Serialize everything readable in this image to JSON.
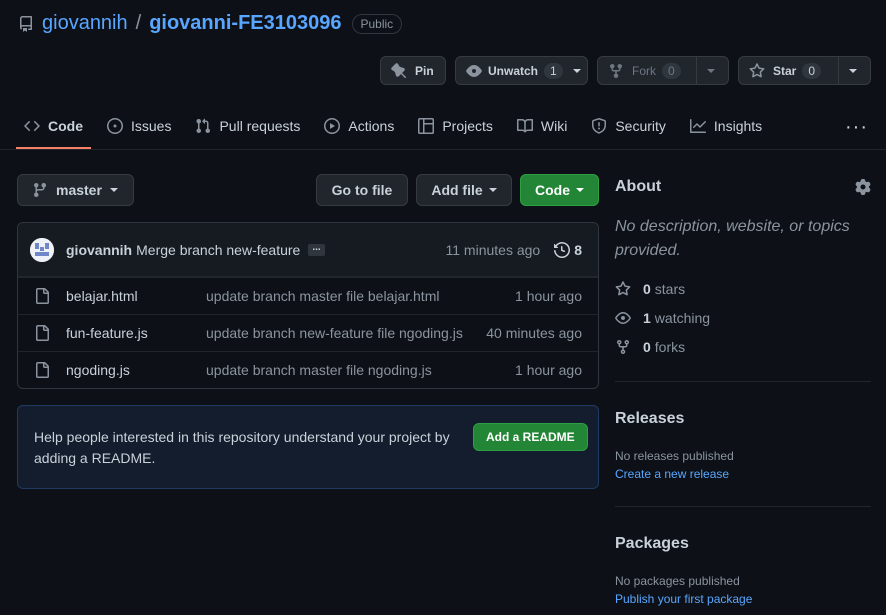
{
  "repo": {
    "owner": "giovannih",
    "separator": "/",
    "name": "giovanni-FE3103096",
    "visibility": "Public"
  },
  "actions": {
    "pin": "Pin",
    "unwatch": "Unwatch",
    "watch_count": "1",
    "fork": "Fork",
    "fork_count": "0",
    "star": "Star",
    "star_count": "0"
  },
  "tabs": [
    {
      "label": "Code",
      "icon": "code-icon",
      "active": true
    },
    {
      "label": "Issues",
      "icon": "issue-icon"
    },
    {
      "label": "Pull requests",
      "icon": "pull-request-icon"
    },
    {
      "label": "Actions",
      "icon": "play-icon"
    },
    {
      "label": "Projects",
      "icon": "table-icon"
    },
    {
      "label": "Wiki",
      "icon": "book-icon"
    },
    {
      "label": "Security",
      "icon": "shield-icon"
    },
    {
      "label": "Insights",
      "icon": "graph-icon"
    }
  ],
  "more": "···",
  "toolbar": {
    "branch": "master",
    "go_to_file": "Go to file",
    "add_file": "Add file",
    "code": "Code"
  },
  "commit": {
    "author": "giovannih",
    "message": "Merge branch new-feature",
    "ellipsis": "...",
    "time": "11 minutes ago",
    "count": "8"
  },
  "files": [
    {
      "name": "belajar.html",
      "message": "update branch master file belajar.html",
      "time": "1 hour ago"
    },
    {
      "name": "fun-feature.js",
      "message": "update branch new-feature file ngoding.js",
      "time": "40 minutes ago"
    },
    {
      "name": "ngoding.js",
      "message": "update branch master file ngoding.js",
      "time": "1 hour ago"
    }
  ],
  "readme": {
    "text": "Help people interested in this repository understand your project by adding a README.",
    "button": "Add a README"
  },
  "about": {
    "title": "About",
    "description": "No description, website, or topics provided.",
    "stars_count": "0",
    "stars_label": "stars",
    "watching_count": "1",
    "watching_label": "watching",
    "forks_count": "0",
    "forks_label": "forks"
  },
  "releases": {
    "title": "Releases",
    "none": "No releases published",
    "link": "Create a new release"
  },
  "packages": {
    "title": "Packages",
    "none": "No packages published",
    "link": "Publish your first package"
  },
  "colors": {
    "background": "#0d1117",
    "link": "#58a6ff",
    "green_button": "#238636",
    "tab_underline": "#f78166"
  }
}
